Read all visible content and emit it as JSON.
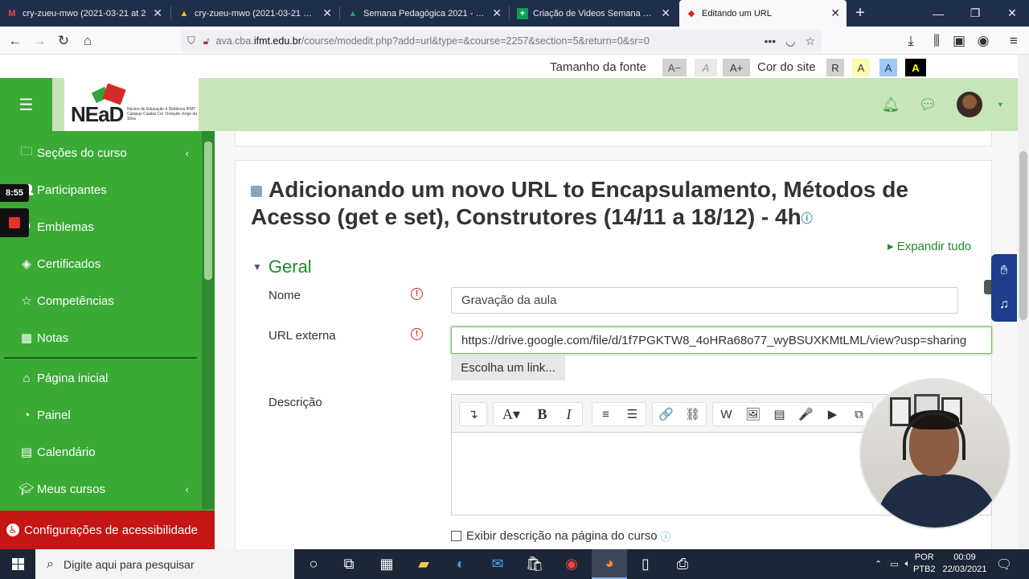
{
  "browser": {
    "tabs": [
      {
        "label": "cry-zueu-mwo (2021-03-21 at 2",
        "icon": "gmail-icon"
      },
      {
        "label": "cry-zueu-mwo (2021-03-21 at 2",
        "icon": "drive-icon"
      },
      {
        "label": "Semana Pedagógica 2021 - Go",
        "icon": "drive-icon"
      },
      {
        "label": "Criação de Videos Semana Ped",
        "icon": "sheets-icon"
      },
      {
        "label": "Editando um URL",
        "icon": "moodle-icon",
        "active": true
      }
    ],
    "url_host": "ava.cba.ifmt.edu.br",
    "url_prefix": "ava.cba.",
    "url_domain": "ifmt.edu.br",
    "url_path": "/course/modedit.php?add=url&type=&course=2257&section=5&return=0&sr=0"
  },
  "font_bar": {
    "font_size_label": "Tamanho da fonte",
    "decrease": "A−",
    "normal": "A",
    "increase": "A+",
    "site_color_label": "Cor do site",
    "reset": "R",
    "color_yellow": "A",
    "color_blue": "A",
    "color_black": "A"
  },
  "logo": {
    "text": "NEaD",
    "subtitle": "Núcleo de Educação à Distância IFMT Campus Cuiabá Cel. Octayde Jorge da Silva"
  },
  "sidebar": {
    "items": [
      {
        "label": "Seções do curso",
        "icon": "folder-icon",
        "arrow": "‹"
      },
      {
        "label": "Participantes",
        "icon": "users-icon"
      },
      {
        "label": "Emblemas",
        "icon": "badge-icon"
      },
      {
        "label": "Certificados",
        "icon": "layers-icon"
      },
      {
        "label": "Competências",
        "icon": "star-icon"
      },
      {
        "label": "Notas",
        "icon": "table-icon"
      },
      {
        "label": "Página inicial",
        "icon": "home-icon"
      },
      {
        "label": "Painel",
        "icon": "dashboard-icon"
      },
      {
        "label": "Calendário",
        "icon": "calendar-icon"
      },
      {
        "label": "Meus cursos",
        "icon": "courses-icon",
        "arrow": "‹"
      }
    ],
    "accessibility": "Configurações de acessibilidade"
  },
  "recording": {
    "time": "8:55"
  },
  "main": {
    "title": "Adicionando um novo URL to Encapsulamento, Métodos de Acesso (get e set), Construtores (14/11 a 18/12) - 4h",
    "expand_all": "Expandir tudo",
    "section": "Geral",
    "fields": {
      "name_label": "Nome",
      "name_value": "Gravação da aula",
      "url_label": "URL externa",
      "url_value": "https://drive.google.com/file/d/1f7PGKTW8_4oHRa68o77_wyBSUXKMtLML/view?usp=sharing",
      "choose_link": "Escolha um link...",
      "description_label": "Descrição",
      "show_description": "Exibir descrição na página do curso"
    },
    "editor_toolbar": [
      "↴",
      "A▾",
      "B",
      "I",
      "≡",
      "☰",
      "🔗",
      "⛓",
      "W",
      "🖼",
      "▤",
      "🎤",
      "▶",
      "⧉"
    ]
  },
  "taskbar": {
    "search_placeholder": "Digite aqui para pesquisar",
    "lang_1": "POR",
    "lang_2": "PTB2",
    "time": "00:09",
    "date": "22/03/2021"
  },
  "colors": {
    "sidebar_green": "#3aaa35",
    "header_green": "#c6e6b9",
    "accessibility_red": "#c61515",
    "link_green": "#1f8a2a"
  }
}
